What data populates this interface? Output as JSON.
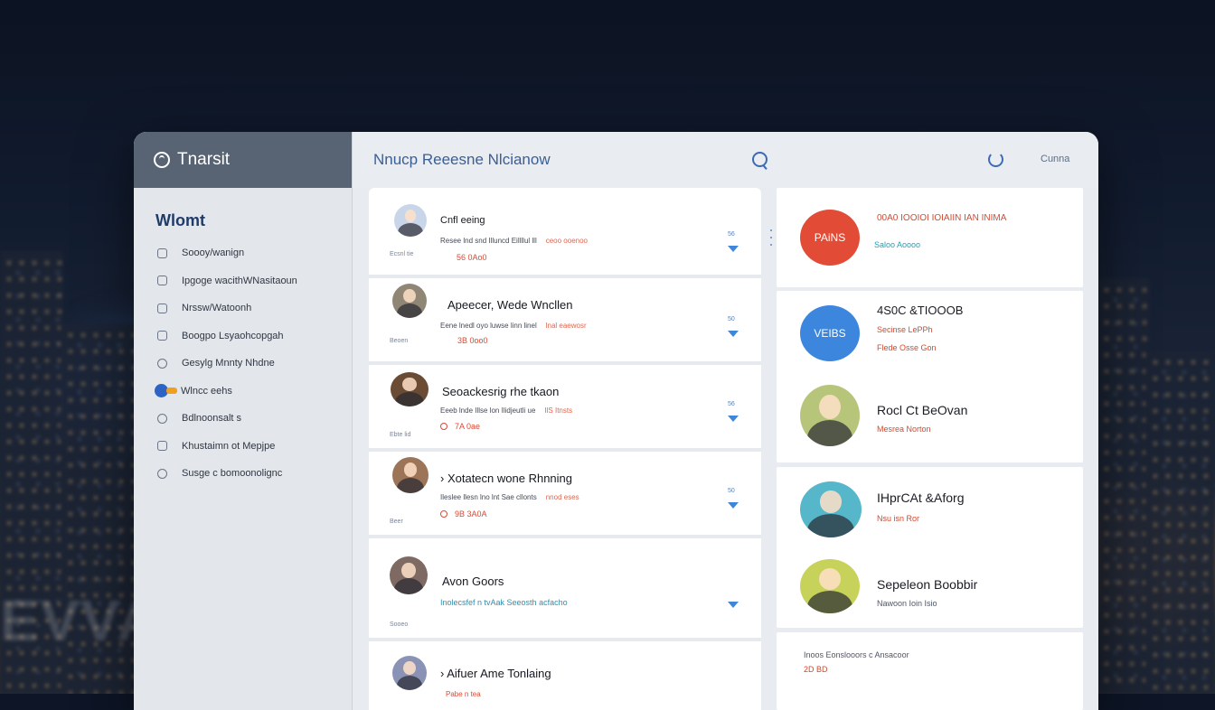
{
  "colors": {
    "brand_bar": "#586474",
    "accent_blue": "#2c63c4",
    "accent_red": "#e24c36",
    "accent_teal": "#1aa3b8",
    "text_dark": "#151820"
  },
  "app": {
    "name": "Tnarsit",
    "logo_icon": "refresh-circle-icon"
  },
  "sidebar": {
    "title": "Wlomt",
    "items": [
      {
        "label": "Soooy/wanign",
        "icon": "dot-square-icon"
      },
      {
        "label": "Ipgoge wacithWNasitaoun",
        "icon": "tag-icon"
      },
      {
        "label": "Nrssw/Watoonh",
        "icon": "card-icon"
      },
      {
        "label": "Boogpo Lsyaohcopgah",
        "icon": "ticket-icon"
      },
      {
        "label": "Gesylg Mnnty Nhdne",
        "icon": "target-icon"
      },
      {
        "label": "Wlncc eehs",
        "icon": "chevron-icon",
        "active": true
      },
      {
        "label": "Bdlnoonsalt s",
        "icon": "circle-icon"
      },
      {
        "label": "Khustaimn ot Mepjpe",
        "icon": "flag-icon"
      },
      {
        "label": "Susge c bomoonolignc",
        "icon": "clock-icon"
      }
    ]
  },
  "header": {
    "title": "Nnucp Reeesne Nlcianow",
    "search_icon": "search-icon",
    "refresh_icon": "refresh-icon",
    "link_label": "Cunna"
  },
  "feed": {
    "cards": [
      {
        "name": "Cnfl eeing",
        "meta": "Resee lnd snd Illuncd Eillllul lll",
        "meta_accent": "ceoo ooenoo",
        "price": "56  0Ao0",
        "tiny": "Ecsnl tie",
        "count": "56"
      },
      {
        "name": "Apeecer, Wede Wncllen",
        "meta": "Eene lnedl oyo luwse linn linel",
        "meta_accent": "lnal eaewosr",
        "price": "3B  0oo0",
        "tiny": "Beoen",
        "count": "50"
      },
      {
        "name": "Seoackesrig rhe tkaon",
        "meta": "Eeeb lnde Illse lon Ilidjeutli ue",
        "meta_accent": "IlS Itnsts",
        "price": "7A  0ae",
        "tiny": "Ebte lid",
        "count": "56"
      },
      {
        "name": "Xotatecn wone Rhnning",
        "meta": "Ileslee llesn lno lnt Sae cllonts",
        "meta_accent": "nnod eses",
        "price": "9B  3A0A",
        "tiny": "Beer",
        "count": "50"
      },
      {
        "name": "Avon Goors",
        "meta": "Inolecsfef n tvAak Seeosth acfacho",
        "price": "",
        "tiny": "Sooeo",
        "count": ""
      },
      {
        "name": "Aifuer Ame Tonlaing",
        "meta": "",
        "price": "Pabe n tea",
        "tiny": "",
        "count": ""
      }
    ]
  },
  "right": {
    "cards": [
      {
        "bubble": "PAiNS",
        "bubble_color": "#e24c36",
        "title": "00A0 IOOIOI IOIAIIN IAN  INIMA",
        "sub": "Saloo  Aoooo"
      },
      {
        "bubble": "VEIBS",
        "bubble_color": "#3c86de",
        "title": "4S0C &TIOOOB",
        "sub": "Secinse LePPh",
        "sub2": "Flede Osse Gon"
      },
      {
        "bubble": "",
        "bubble_color": "#b7c57b",
        "title": "Rocl Ct BeOvan",
        "sub": "Mesrea Norton"
      },
      {
        "bubble": "",
        "bubble_color": "#55b7c9",
        "title": "IHprCAt &Aforg",
        "sub": "Nsu isn Ror"
      },
      {
        "bubble": "",
        "bubble_color": "#c7d25a",
        "title": "Sepeleon Boobbir",
        "sub": "Nawoon Ioin Isio"
      },
      {
        "title": "Inoos Eonslooors c Ansacoor",
        "sub": "2D  BD"
      }
    ]
  }
}
